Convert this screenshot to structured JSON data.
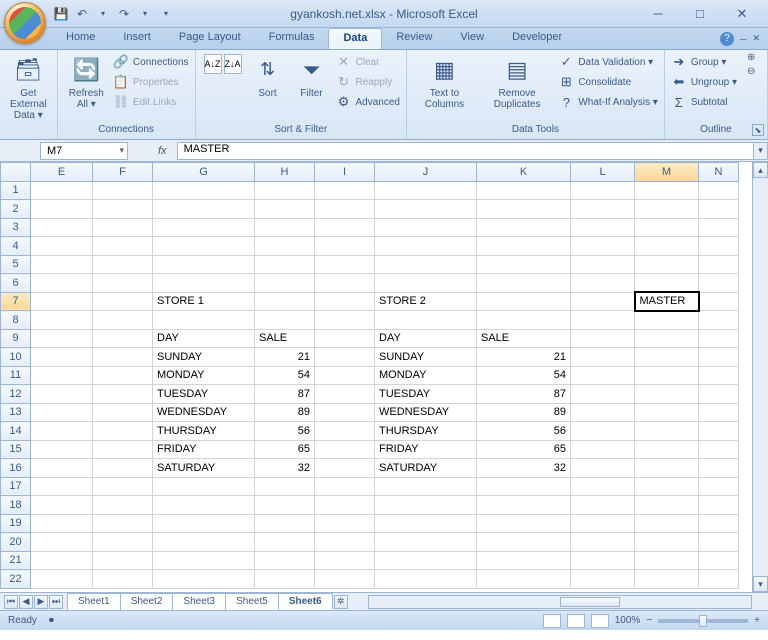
{
  "title": "gyankosh.net.xlsx - Microsoft Excel",
  "tabs": {
    "home": "Home",
    "insert": "Insert",
    "pagelayout": "Page Layout",
    "formulas": "Formulas",
    "data": "Data",
    "review": "Review",
    "view": "View",
    "developer": "Developer"
  },
  "ribbon": {
    "getdata": "Get External Data ▾",
    "refresh": "Refresh All ▾",
    "connections": "Connections",
    "properties": "Properties",
    "editlinks": "Edit Links",
    "grp_connections": "Connections",
    "sort": "Sort",
    "filter": "Filter",
    "clear": "Clear",
    "reapply": "Reapply",
    "advanced": "Advanced",
    "grp_sortfilter": "Sort & Filter",
    "t2c": "Text to Columns",
    "remdup": "Remove Duplicates",
    "dataval": "Data Validation ▾",
    "consol": "Consolidate",
    "whatif": "What-If Analysis ▾",
    "grp_datatools": "Data Tools",
    "group": "Group ▾",
    "ungroup": "Ungroup ▾",
    "subtotal": "Subtotal",
    "grp_outline": "Outline"
  },
  "fbar": {
    "name": "M7",
    "fx": "fx",
    "formula": "MASTER"
  },
  "cols": [
    "E",
    "F",
    "G",
    "H",
    "I",
    "J",
    "K",
    "L",
    "M",
    "N"
  ],
  "rows": [
    "1",
    "2",
    "3",
    "4",
    "5",
    "6",
    "7",
    "8",
    "9",
    "10",
    "11",
    "12",
    "13",
    "14",
    "15",
    "16",
    "17",
    "18",
    "19",
    "20",
    "21",
    "22"
  ],
  "cells": {
    "G7": "STORE 1",
    "J7": "STORE 2",
    "M7": "MASTER",
    "G9": "DAY",
    "H9": "SALE",
    "J9": "DAY",
    "K9": "SALE",
    "G10": "SUNDAY",
    "H10": "21",
    "J10": "SUNDAY",
    "K10": "21",
    "G11": "MONDAY",
    "H11": "54",
    "J11": "MONDAY",
    "K11": "54",
    "G12": "TUESDAY",
    "H12": "87",
    "J12": "TUESDAY",
    "K12": "87",
    "G13": "WEDNESDAY",
    "H13": "89",
    "J13": "WEDNESDAY",
    "K13": "89",
    "G14": "THURSDAY",
    "H14": "56",
    "J14": "THURSDAY",
    "K14": "56",
    "G15": "FRIDAY",
    "H15": "65",
    "J15": "FRIDAY",
    "K15": "65",
    "G16": "SATURDAY",
    "H16": "32",
    "J16": "SATURDAY",
    "K16": "32"
  },
  "selected_cell": "M7",
  "sheets": [
    "Sheet1",
    "Sheet2",
    "Sheet3",
    "Sheet5",
    "Sheet6"
  ],
  "active_sheet": "Sheet6",
  "status": {
    "ready": "Ready",
    "zoom": "100%"
  }
}
